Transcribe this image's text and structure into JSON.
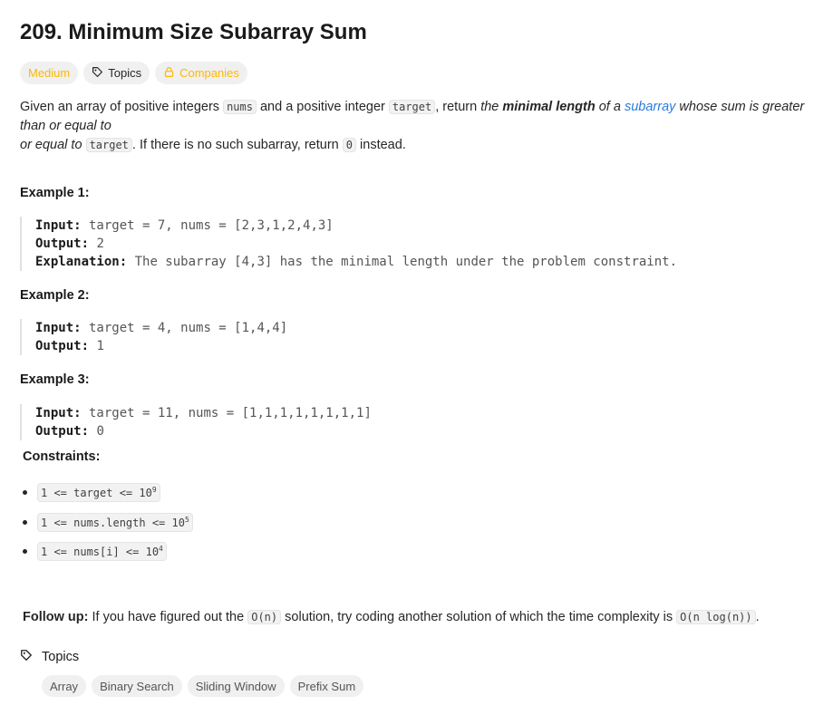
{
  "problem": {
    "title": "209. Minimum Size Subarray Sum"
  },
  "tags": {
    "difficulty": "Medium",
    "topics": "Topics",
    "companies": "Companies"
  },
  "description": {
    "p1": "Given an array of positive integers ",
    "c1": "nums",
    "p2": " and a positive integer ",
    "c2": "target",
    "p3": ", return ",
    "p4": "the ",
    "bold": "minimal length",
    "p5": " of a ",
    "link": "subarray",
    "p6": " whose sum is greater than or equal to",
    "p7": " ",
    "c3": "target",
    "p8": ". If there is no such subarray, return ",
    "c4": "0",
    "p9": " instead."
  },
  "examples": [
    {
      "heading": "Example 1:",
      "input_label": "Input:",
      "input": " target = 7, nums = [2,3,1,2,4,3]",
      "output_label": "Output:",
      "output": " 2",
      "explanation_label": "Explanation:",
      "explanation": " The subarray [4,3] has the minimal length under the problem constraint."
    },
    {
      "heading": "Example 2:",
      "input_label": "Input:",
      "input": " target = 4, nums = [1,4,4]",
      "output_label": "Output:",
      "output": " 1"
    },
    {
      "heading": "Example 3:",
      "input_label": "Input:",
      "input": " target = 11, nums = [1,1,1,1,1,1,1,1]",
      "output_label": "Output:",
      "output": " 0"
    }
  ],
  "constraints": {
    "heading": "Constraints:",
    "items": [
      {
        "text": "1 <= target <= 10",
        "exp": "9"
      },
      {
        "text": "1 <= nums.length <= 10",
        "exp": "5"
      },
      {
        "text": "1 <= nums[i] <= 10",
        "exp": "4"
      }
    ]
  },
  "followup": {
    "label": "Follow up:",
    "t1": " If you have figured out the ",
    "c1": "O(n)",
    "t2": " solution, try coding another solution of which the time complexity is ",
    "c2": "O(n log(n))",
    "t3": "."
  },
  "topics_section": {
    "label": "Topics",
    "tags": [
      "Array",
      "Binary Search",
      "Sliding Window",
      "Prefix Sum"
    ]
  },
  "colors": {
    "medium": "#ffb800",
    "link": "#2a7ae2",
    "pill_bg": "#f0f0f0"
  },
  "icons": {
    "topics": "tag-icon",
    "companies": "lock-icon"
  }
}
